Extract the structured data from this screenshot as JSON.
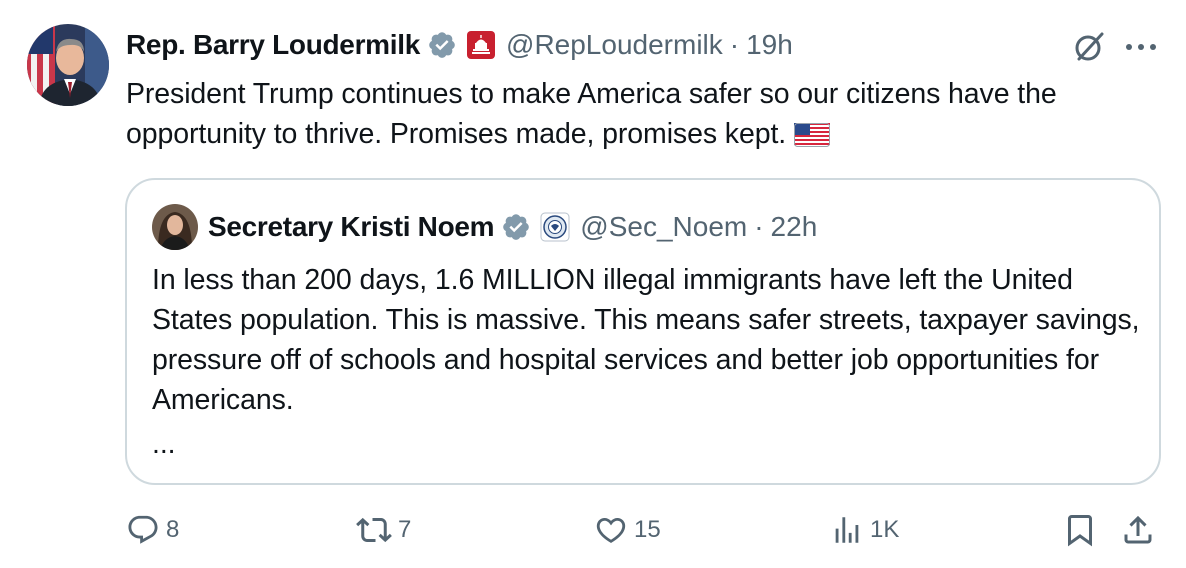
{
  "tweet": {
    "author_name": "Rep. Barry Loudermilk",
    "handle": "@RepLoudermilk",
    "separator": "·",
    "time": "19h",
    "text": "President Trump continues to make America safer so our citizens have the opportunity to thrive. Promises made, promises kept.",
    "flag_emoji": "us-flag-icon"
  },
  "quoted": {
    "author_name": "Secretary Kristi Noem",
    "handle": "@Sec_Noem",
    "separator": "·",
    "time": "22h",
    "text": "In less than 200 days, 1.6 MILLION illegal immigrants have left the United States population. This is massive. This means safer streets, taxpayer savings, pressure off of schools and hospital services and better job opportunities for Americans.",
    "ellipsis": "..."
  },
  "actions": {
    "replies": "8",
    "reposts": "7",
    "likes": "15",
    "views": "1K"
  },
  "colors": {
    "text": "#0f1419",
    "secondary": "#536471",
    "verified_badge": "#829aab",
    "border": "#cfd9de",
    "affiliation_red": "#c8202f"
  }
}
